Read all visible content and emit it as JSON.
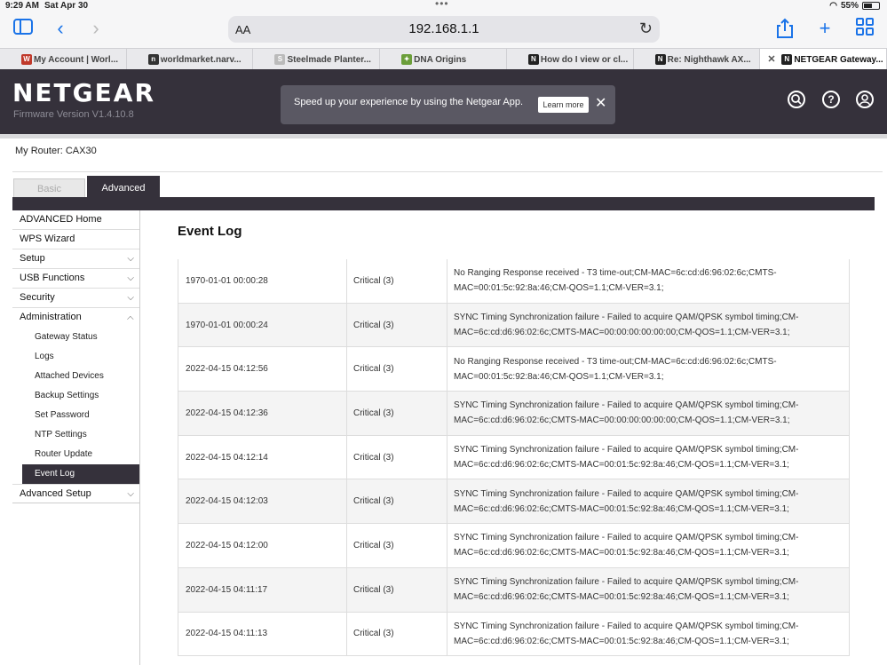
{
  "status": {
    "time": "9:29 AM",
    "date": "Sat Apr 30",
    "battery": "55%",
    "battery_level": 0.55
  },
  "browser": {
    "text_size_label": "AA",
    "url": "192.168.1.1",
    "tabs": [
      {
        "label": "My Account | Worl...",
        "fav": "W",
        "fav_color": "#c0392b"
      },
      {
        "label": "worldmarket.narv...",
        "fav": "n",
        "fav_color": "#333333"
      },
      {
        "label": "Steelmade Planter...",
        "fav": "S",
        "fav_color": "#bbbbbb"
      },
      {
        "label": "DNA Origins",
        "fav": "✦",
        "fav_color": "#6b9e3a"
      },
      {
        "label": "How do I view or cl...",
        "fav": "N",
        "fav_color": "#222222"
      },
      {
        "label": "Re: Nighthawk AX...",
        "fav": "N",
        "fav_color": "#222222"
      },
      {
        "label": "NETGEAR Gateway...",
        "fav": "N",
        "fav_color": "#222222"
      }
    ]
  },
  "header": {
    "logo": "NETGEAR",
    "firmware": "Firmware Version V1.4.10.8",
    "banner_message": "Speed up your experience by using the Netgear App.",
    "learn_more": "Learn more"
  },
  "router": {
    "label": "My Router:",
    "model": "CAX30"
  },
  "mode_tabs": {
    "basic": "Basic",
    "advanced": "Advanced"
  },
  "sidebar": {
    "items": [
      {
        "label": "ADVANCED Home"
      },
      {
        "label": "WPS Wizard"
      },
      {
        "label": "Setup"
      },
      {
        "label": "USB Functions"
      },
      {
        "label": "Security"
      },
      {
        "label": "Administration"
      }
    ],
    "admin_subitems": [
      "Gateway Status",
      "Logs",
      "Attached Devices",
      "Backup Settings",
      "Set Password",
      "NTP Settings",
      "Router Update",
      "Event Log"
    ],
    "advanced_setup": "Advanced Setup"
  },
  "page_title": "Event Log",
  "events": [
    {
      "time": "1970-01-01 00:00:28",
      "level": "Critical (3)",
      "desc": "No Ranging Response received - T3 time-out;CM-MAC=6c:cd:d6:96:02:6c;CMTS-MAC=00:01:5c:92:8a:46;CM-QOS=1.1;CM-VER=3.1;"
    },
    {
      "time": "1970-01-01 00:00:24",
      "level": "Critical (3)",
      "desc": "SYNC Timing Synchronization failure - Failed to acquire QAM/QPSK symbol timing;CM-MAC=6c:cd:d6:96:02:6c;CMTS-MAC=00:00:00:00:00:00;CM-QOS=1.1;CM-VER=3.1;"
    },
    {
      "time": "2022-04-15 04:12:56",
      "level": "Critical (3)",
      "desc": "No Ranging Response received - T3 time-out;CM-MAC=6c:cd:d6:96:02:6c;CMTS-MAC=00:01:5c:92:8a:46;CM-QOS=1.1;CM-VER=3.1;"
    },
    {
      "time": "2022-04-15 04:12:36",
      "level": "Critical (3)",
      "desc": "SYNC Timing Synchronization failure - Failed to acquire QAM/QPSK symbol timing;CM-MAC=6c:cd:d6:96:02:6c;CMTS-MAC=00:00:00:00:00:00;CM-QOS=1.1;CM-VER=3.1;"
    },
    {
      "time": "2022-04-15 04:12:14",
      "level": "Critical (3)",
      "desc": "SYNC Timing Synchronization failure - Failed to acquire QAM/QPSK symbol timing;CM-MAC=6c:cd:d6:96:02:6c;CMTS-MAC=00:01:5c:92:8a:46;CM-QOS=1.1;CM-VER=3.1;"
    },
    {
      "time": "2022-04-15 04:12:03",
      "level": "Critical (3)",
      "desc": "SYNC Timing Synchronization failure - Failed to acquire QAM/QPSK symbol timing;CM-MAC=6c:cd:d6:96:02:6c;CMTS-MAC=00:01:5c:92:8a:46;CM-QOS=1.1;CM-VER=3.1;"
    },
    {
      "time": "2022-04-15 04:12:00",
      "level": "Critical (3)",
      "desc": "SYNC Timing Synchronization failure - Failed to acquire QAM/QPSK symbol timing;CM-MAC=6c:cd:d6:96:02:6c;CMTS-MAC=00:01:5c:92:8a:46;CM-QOS=1.1;CM-VER=3.1;"
    },
    {
      "time": "2022-04-15 04:11:17",
      "level": "Critical (3)",
      "desc": "SYNC Timing Synchronization failure - Failed to acquire QAM/QPSK symbol timing;CM-MAC=6c:cd:d6:96:02:6c;CMTS-MAC=00:01:5c:92:8a:46;CM-QOS=1.1;CM-VER=3.1;"
    },
    {
      "time": "2022-04-15 04:11:13",
      "level": "Critical (3)",
      "desc": "SYNC Timing Synchronization failure - Failed to acquire QAM/QPSK symbol timing;CM-MAC=6c:cd:d6:96:02:6c;CMTS-MAC=00:01:5c:92:8a:46;CM-QOS=1.1;CM-VER=3.1;"
    }
  ],
  "colors": {
    "header_bg": "#35313b",
    "accent_blue": "#1a73e8",
    "banner_bg": "#5a5863"
  }
}
